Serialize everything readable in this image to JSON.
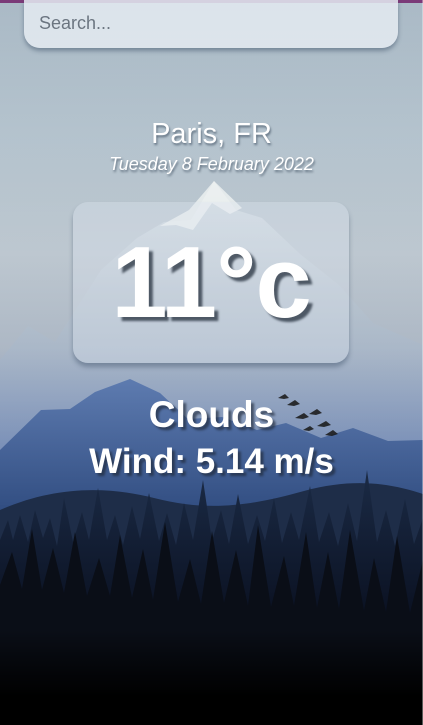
{
  "search": {
    "placeholder": "Search...",
    "value": ""
  },
  "weather": {
    "location": "Paris, FR",
    "date": "Tuesday 8 February 2022",
    "temperature": "11°c",
    "condition": "Clouds",
    "wind": "Wind: 5.14 m/s"
  },
  "icons": {
    "background": "mountain-forest-background",
    "birds": "flying-birds-icon"
  },
  "colors": {
    "text": "#ffffff",
    "accent": "#7b3a78",
    "search_background": "#e4eaf1"
  }
}
